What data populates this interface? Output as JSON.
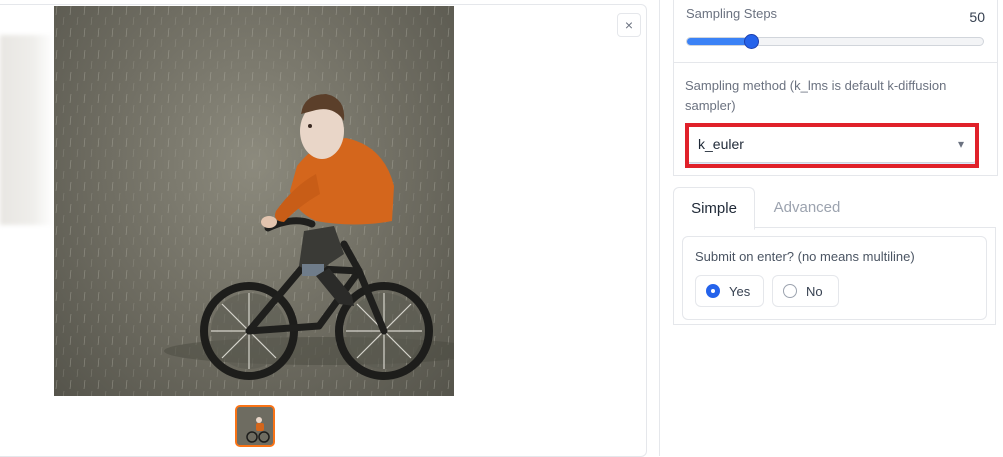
{
  "gallery": {
    "close_icon_glyph": "×"
  },
  "sampling_steps": {
    "label": "Sampling Steps",
    "value": "50",
    "slider_fraction": 0.215
  },
  "sampling_method": {
    "label": "Sampling method (k_lms is default k-diffusion sampler)",
    "selected": "k_euler",
    "chevron_glyph": "▾"
  },
  "tabs": [
    {
      "label": "Simple",
      "active": true
    },
    {
      "label": "Advanced",
      "active": false
    }
  ],
  "submit_on_enter": {
    "label": "Submit on enter? (no means multiline)",
    "options": [
      {
        "label": "Yes",
        "checked": true
      },
      {
        "label": "No",
        "checked": false
      }
    ]
  },
  "colors": {
    "accent": "#2563eb",
    "highlight": "#e0212a",
    "thumb_border": "#f97316"
  }
}
